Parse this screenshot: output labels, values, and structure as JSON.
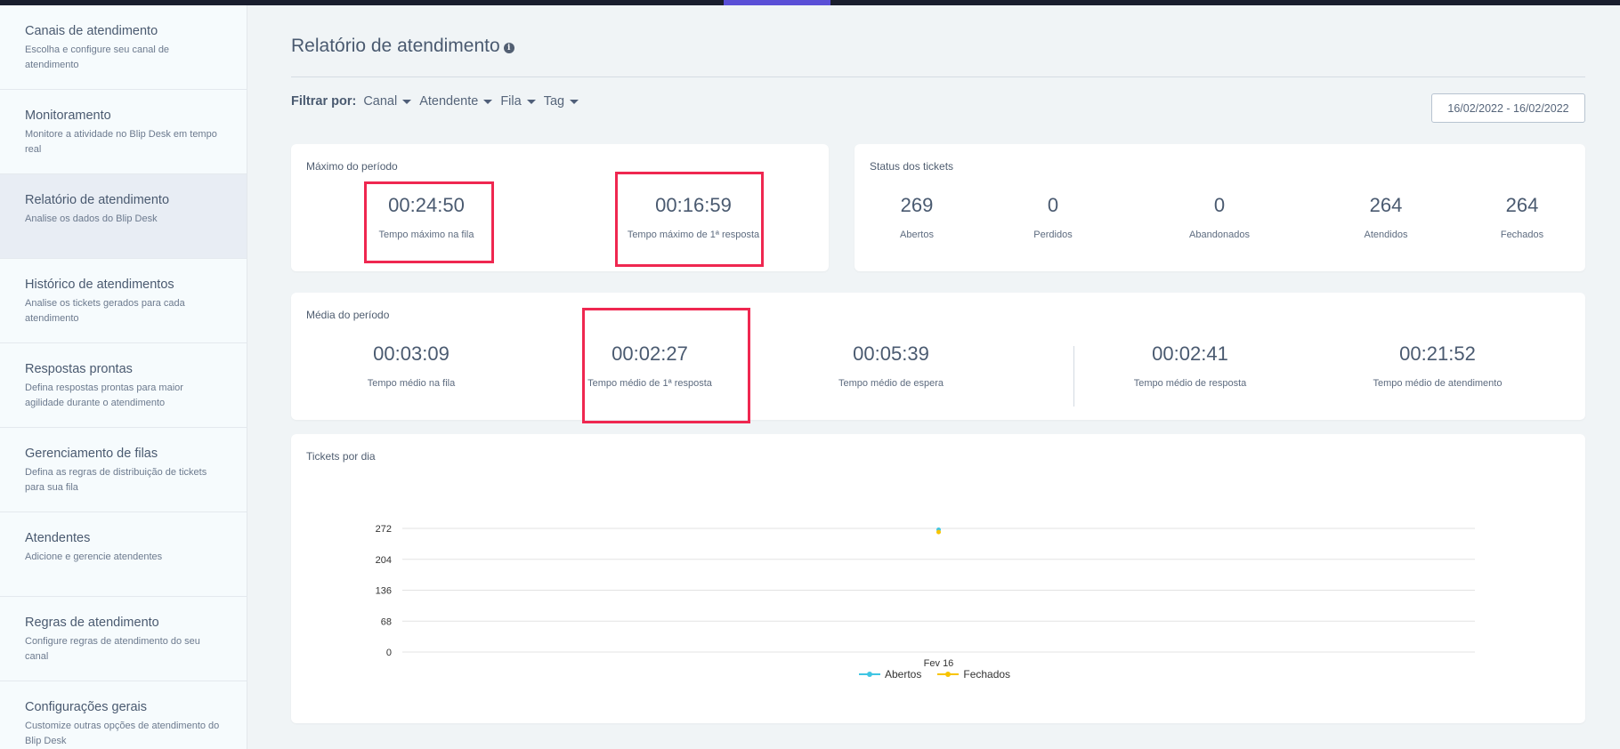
{
  "colors": {
    "accent": "#5a4fd6",
    "highlight": "#ef2750",
    "series_abertos": "#3fc5e3",
    "series_fechados": "#f8c400"
  },
  "sidebar": {
    "items": [
      {
        "title": "Canais de atendimento",
        "desc": "Escolha e configure seu canal de atendimento"
      },
      {
        "title": "Monitoramento",
        "desc": "Monitore a atividade no Blip Desk em tempo real"
      },
      {
        "title": "Relatório de atendimento",
        "desc": "Analise os dados do Blip Desk",
        "active": true
      },
      {
        "title": "Histórico de atendimentos",
        "desc": "Analise os tickets gerados para cada atendimento"
      },
      {
        "title": "Respostas prontas",
        "desc": "Defina respostas prontas para maior agilidade durante o atendimento"
      },
      {
        "title": "Gerenciamento de filas",
        "desc": "Defina as regras de distribuição de tickets para sua fila"
      },
      {
        "title": "Atendentes",
        "desc": "Adicione e gerencie atendentes"
      },
      {
        "title": "Regras de atendimento",
        "desc": "Configure regras de atendimento do seu canal"
      },
      {
        "title": "Configurações gerais",
        "desc": "Customize outras opções de atendimento do Blip Desk"
      }
    ]
  },
  "header": {
    "title": "Relatório de atendimento",
    "info_icon": "info-icon"
  },
  "filters": {
    "label": "Filtrar por:",
    "items": [
      "Canal",
      "Atendente",
      "Fila",
      "Tag"
    ],
    "date_range": "16/02/2022 - 16/02/2022"
  },
  "max_card": {
    "title": "Máximo do período",
    "metrics": [
      {
        "value": "00:24:50",
        "label": "Tempo máximo na fila"
      },
      {
        "value": "00:16:59",
        "label": "Tempo máximo de 1ª resposta"
      }
    ]
  },
  "status_card": {
    "title": "Status dos tickets",
    "metrics": [
      {
        "value": "269",
        "label": "Abertos"
      },
      {
        "value": "0",
        "label": "Perdidos"
      },
      {
        "value": "0",
        "label": "Abandonados"
      },
      {
        "value": "264",
        "label": "Atendidos"
      },
      {
        "value": "264",
        "label": "Fechados"
      }
    ]
  },
  "avg_card": {
    "title": "Média do período",
    "metrics": [
      {
        "value": "00:03:09",
        "label": "Tempo médio na fila"
      },
      {
        "value": "00:02:27",
        "label": "Tempo médio de 1ª resposta"
      },
      {
        "value": "00:05:39",
        "label": "Tempo médio de espera"
      },
      {
        "value": "00:02:41",
        "label": "Tempo médio de resposta"
      },
      {
        "value": "00:21:52",
        "label": "Tempo médio de atendimento"
      }
    ]
  },
  "chart_card": {
    "title": "Tickets por dia"
  },
  "chart_data": {
    "type": "line",
    "title": "Tickets por dia",
    "categories": [
      "Fev 16"
    ],
    "yticks": [
      0,
      68,
      136,
      204,
      272
    ],
    "ylim": [
      0,
      272
    ],
    "grid": true,
    "legend_position": "bottom",
    "series": [
      {
        "name": "Abertos",
        "values": [
          269
        ],
        "color": "#3fc5e3"
      },
      {
        "name": "Fechados",
        "values": [
          264
        ],
        "color": "#f8c400"
      }
    ]
  }
}
